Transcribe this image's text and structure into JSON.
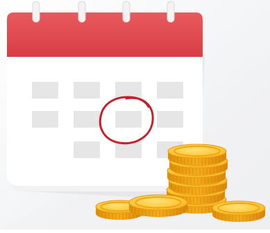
{
  "illustration": {
    "calendar": {
      "header_color": "#e0474c",
      "body_color": "#ffffff",
      "cell_color": "#e6e6e6",
      "ring_color": "#f3f3f3",
      "ring_count": 4,
      "rows": [
        4,
        4,
        3
      ],
      "marked_cell": {
        "row": 2,
        "col": 3
      },
      "circle_mark_color": "#c8202a"
    },
    "coins": {
      "color_light": "#ffd54a",
      "color_mid": "#f7b21b",
      "color_dark": "#d88a06",
      "stack_count": 6,
      "loose_count": 3
    },
    "background_color": "#eef0f3"
  }
}
